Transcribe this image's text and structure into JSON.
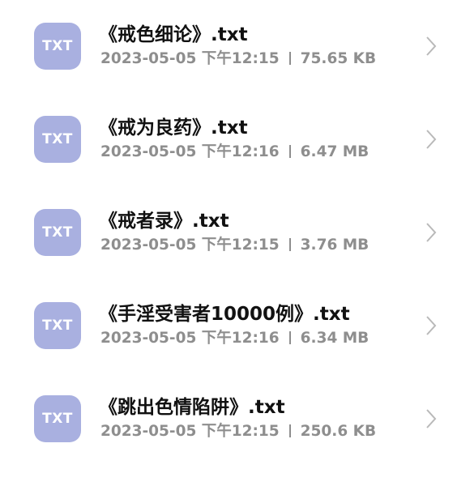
{
  "files": [
    {
      "icon_label": "TXT",
      "name": "《戒色细论》.txt",
      "date": "2023-05-05 下午12:15",
      "size": "75.65 KB",
      "icon": "chevron-right-icon"
    },
    {
      "icon_label": "TXT",
      "name": "《戒为良药》.txt",
      "date": "2023-05-05 下午12:16",
      "size": "6.47 MB",
      "icon": "chevron-right-icon"
    },
    {
      "icon_label": "TXT",
      "name": "《戒者录》.txt",
      "date": "2023-05-05 下午12:15",
      "size": "3.76 MB",
      "icon": "chevron-right-icon"
    },
    {
      "icon_label": "TXT",
      "name": "《手淫受害者10000例》.txt",
      "date": "2023-05-05 下午12:16",
      "size": "6.34 MB",
      "icon": "chevron-right-icon"
    },
    {
      "icon_label": "TXT",
      "name": "《跳出色情陷阱》.txt",
      "date": "2023-05-05 下午12:15",
      "size": "250.6 KB",
      "icon": "chevron-right-icon"
    }
  ],
  "colors": {
    "icon_bg": "#a9b0e0",
    "meta_text": "#8e8e8e",
    "chevron": "#b9b9b9"
  }
}
